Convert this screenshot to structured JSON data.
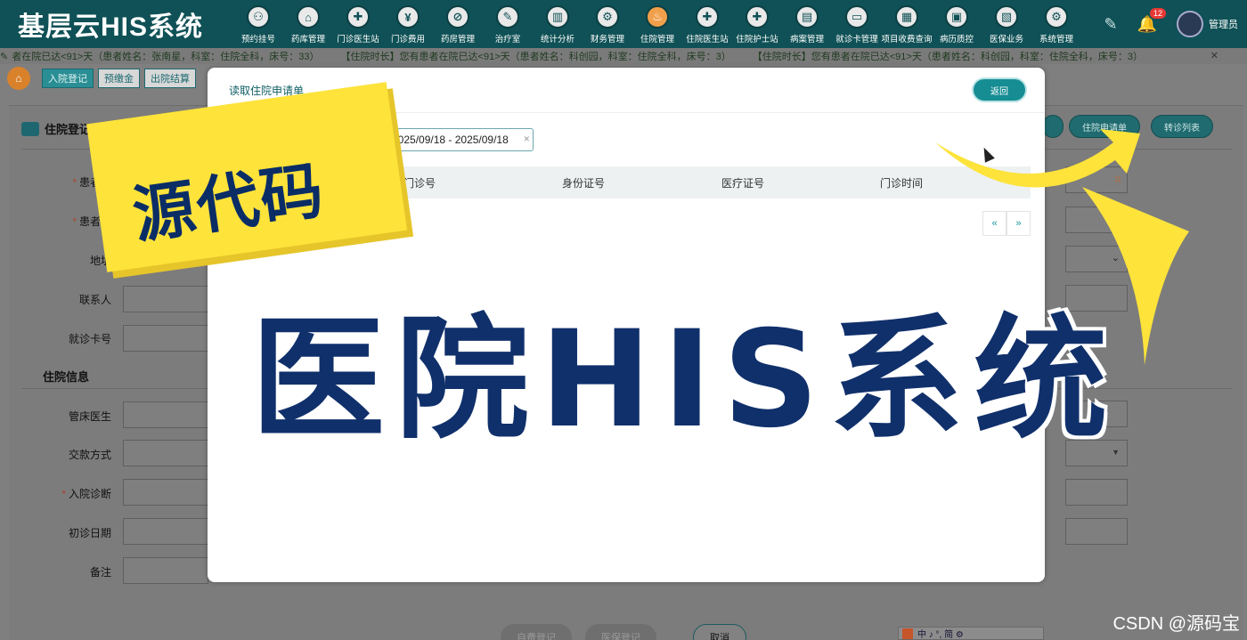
{
  "app": {
    "title": "基层云HIS系统"
  },
  "nav": [
    {
      "label": "预约挂号",
      "icon": "calendar-icon",
      "glyph": "⚇"
    },
    {
      "label": "药库管理",
      "icon": "warehouse-icon",
      "glyph": "⌂"
    },
    {
      "label": "门诊医生站",
      "icon": "doctor-icon",
      "glyph": "✚"
    },
    {
      "label": "门诊费用",
      "icon": "yen-icon",
      "glyph": "¥"
    },
    {
      "label": "药房管理",
      "icon": "pill-icon",
      "glyph": "⊘"
    },
    {
      "label": "治疗室",
      "icon": "treatment-icon",
      "glyph": "✎"
    },
    {
      "label": "统计分析",
      "icon": "chart-icon",
      "glyph": "▥"
    },
    {
      "label": "财务管理",
      "icon": "finance-icon",
      "glyph": "⚙"
    },
    {
      "label": "住院管理",
      "icon": "inpatient-icon",
      "glyph": "♨",
      "active": true
    },
    {
      "label": "住院医生站",
      "icon": "ward-doctor-icon",
      "glyph": "✚"
    },
    {
      "label": "住院护士站",
      "icon": "nurse-icon",
      "glyph": "✚"
    },
    {
      "label": "病案管理",
      "icon": "record-icon",
      "glyph": "▤"
    },
    {
      "label": "就诊卡管理",
      "icon": "card-icon",
      "glyph": "▭"
    },
    {
      "label": "项目收费查询",
      "icon": "billing-icon",
      "glyph": "▦"
    },
    {
      "label": "病历质控",
      "icon": "quality-icon",
      "glyph": "▣"
    },
    {
      "label": "医保业务",
      "icon": "insurance-icon",
      "glyph": "▧"
    },
    {
      "label": "系统管理",
      "icon": "settings-icon",
      "glyph": "⚙"
    }
  ],
  "header_right": {
    "badge_count": "12",
    "user": "管理员"
  },
  "marquee": [
    "者在院已达<91>天（患者姓名：张南星，科室：住院全科，床号：33）",
    "【住院时长】您有患者在院已达<91>天（患者姓名：科创园，科室：住院全科，床号：3）",
    "【住院时长】您有患者在院已达<91>天（患者姓名：科创园，科室：住院全科，床号：3）"
  ],
  "actions": {
    "admit": "入院登记",
    "deposit": "预缴金",
    "discharge": "出院结算"
  },
  "panel": {
    "title": "住院登记",
    "right_buttons": {
      "apply": "住院申请单",
      "transfer": "转诊列表"
    },
    "labels": {
      "patient_name": "患者姓",
      "patient_type": "患者类",
      "address": "地址",
      "contact": "联系人",
      "card_no": "就诊卡号",
      "section_inpatient": "住院信息",
      "bed_doctor": "管床医生",
      "payment": "交款方式",
      "diagnosis": "入院诊断",
      "first_visit": "初诊日期",
      "remark": "备注"
    },
    "bottom_buttons": {
      "self_pay": "自费登记",
      "insurance": "医保登记",
      "cancel": "取消"
    }
  },
  "modal": {
    "title": "读取住院申请单",
    "back": "返回",
    "date_range": "2025/09/18 - 2025/09/18",
    "columns": [
      "门诊号",
      "身份证号",
      "医疗证号",
      "门诊时间"
    ],
    "pager_prev": "«",
    "pager_next": "»"
  },
  "promo": {
    "sticker": "源代码",
    "title": "医院HIS系统"
  },
  "ime": {
    "text": "中 ♪ °, 简 ⚙"
  },
  "watermark": "CSDN @源码宝"
}
